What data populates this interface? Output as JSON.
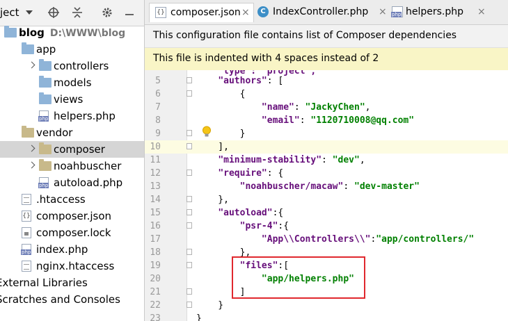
{
  "project_panel": {
    "title": "ject",
    "tree": [
      {
        "label": "blog",
        "hint": "D:\\WWW\\blog",
        "kind": "folder",
        "indent": 0,
        "arrow": "none",
        "bold": true
      },
      {
        "label": "app",
        "kind": "folder",
        "indent": 1,
        "arrow": "none"
      },
      {
        "label": "controllers",
        "kind": "folder",
        "indent": 2,
        "arrow": "closed"
      },
      {
        "label": "models",
        "kind": "folder",
        "indent": 2,
        "arrow": "none"
      },
      {
        "label": "views",
        "kind": "folder",
        "indent": 2,
        "arrow": "none"
      },
      {
        "label": "helpers.php",
        "kind": "php",
        "indent": 2,
        "arrow": "none"
      },
      {
        "label": "vendor",
        "kind": "folder-excluded",
        "indent": 1,
        "arrow": "none"
      },
      {
        "label": "composer",
        "kind": "folder-excluded",
        "indent": 2,
        "arrow": "closed",
        "selected": true
      },
      {
        "label": "noahbuscher",
        "kind": "folder-excluded",
        "indent": 2,
        "arrow": "closed"
      },
      {
        "label": "autoload.php",
        "kind": "php",
        "indent": 2,
        "arrow": "none"
      },
      {
        "label": ".htaccess",
        "kind": "text",
        "indent": 1,
        "arrow": "none"
      },
      {
        "label": "composer.json",
        "kind": "json",
        "indent": 1,
        "arrow": "none"
      },
      {
        "label": "composer.lock",
        "kind": "lock",
        "indent": 1,
        "arrow": "none"
      },
      {
        "label": "index.php",
        "kind": "php",
        "indent": 1,
        "arrow": "none"
      },
      {
        "label": "nginx.htaccess",
        "kind": "text",
        "indent": 1,
        "arrow": "none"
      },
      {
        "label": "External Libraries",
        "kind": "lib",
        "indent": 0,
        "arrow": "none"
      },
      {
        "label": "Scratches and Consoles",
        "kind": "scratch",
        "indent": 0,
        "arrow": "none"
      }
    ]
  },
  "tabs": [
    {
      "label": "composer.json",
      "icon": "json-file-icon",
      "active": true
    },
    {
      "label": "IndexController.php",
      "icon": "php-class-icon",
      "active": false
    },
    {
      "label": "helpers.php",
      "icon": "php-file-icon",
      "active": false
    }
  ],
  "notices": {
    "info": "This configuration file contains list of Composer dependencies",
    "warning": "This file is indented with 4 spaces instead of 2"
  },
  "editor": {
    "first_partial_line": [
      {
        "t": "    \"type\": \"project\",",
        "c": "p"
      }
    ],
    "lines": [
      {
        "n": "5",
        "segs": [
          {
            "t": "    "
          },
          {
            "t": "\"authors\"",
            "c": "k"
          },
          {
            "t": ": ["
          }
        ]
      },
      {
        "n": "6",
        "segs": [
          {
            "t": "        {"
          }
        ]
      },
      {
        "n": "7",
        "segs": [
          {
            "t": "            "
          },
          {
            "t": "\"name\"",
            "c": "k"
          },
          {
            "t": ": "
          },
          {
            "t": "\"JackyChen\"",
            "c": "s"
          },
          {
            "t": ","
          }
        ]
      },
      {
        "n": "8",
        "segs": [
          {
            "t": "            "
          },
          {
            "t": "\"email\"",
            "c": "k"
          },
          {
            "t": ": "
          },
          {
            "t": "\"1120710008@qq.com\"",
            "c": "s"
          }
        ]
      },
      {
        "n": "9",
        "segs": [
          {
            "t": "        }"
          }
        ]
      },
      {
        "n": "10",
        "segs": [
          {
            "t": "    ],"
          }
        ],
        "current": true
      },
      {
        "n": "11",
        "segs": [
          {
            "t": "    "
          },
          {
            "t": "\"minimum-stability\"",
            "c": "k"
          },
          {
            "t": ": "
          },
          {
            "t": "\"dev\"",
            "c": "s"
          },
          {
            "t": ","
          }
        ]
      },
      {
        "n": "12",
        "segs": [
          {
            "t": "    "
          },
          {
            "t": "\"require\"",
            "c": "k"
          },
          {
            "t": ": {"
          }
        ]
      },
      {
        "n": "13",
        "segs": [
          {
            "t": "        "
          },
          {
            "t": "\"noahbuscher/macaw\"",
            "c": "k"
          },
          {
            "t": ": "
          },
          {
            "t": "\"dev-master\"",
            "c": "s"
          }
        ]
      },
      {
        "n": "14",
        "segs": [
          {
            "t": "    },"
          }
        ]
      },
      {
        "n": "15",
        "segs": [
          {
            "t": "    "
          },
          {
            "t": "\"autoload\"",
            "c": "k"
          },
          {
            "t": ":{"
          }
        ]
      },
      {
        "n": "16",
        "segs": [
          {
            "t": "        "
          },
          {
            "t": "\"psr-4\"",
            "c": "k"
          },
          {
            "t": ":{"
          }
        ]
      },
      {
        "n": "17",
        "segs": [
          {
            "t": "            "
          },
          {
            "t": "\"App\\\\Controllers\\\\\"",
            "c": "k"
          },
          {
            "t": ":"
          },
          {
            "t": "\"app/controllers/\"",
            "c": "s"
          }
        ]
      },
      {
        "n": "18",
        "segs": [
          {
            "t": "        },"
          }
        ]
      },
      {
        "n": "19",
        "segs": [
          {
            "t": "        "
          },
          {
            "t": "\"files\"",
            "c": "k"
          },
          {
            "t": ":["
          }
        ]
      },
      {
        "n": "20",
        "segs": [
          {
            "t": "            "
          },
          {
            "t": "\"app/helpers.php\"",
            "c": "s"
          }
        ]
      },
      {
        "n": "21",
        "segs": [
          {
            "t": "        ]"
          }
        ]
      },
      {
        "n": "22",
        "segs": [
          {
            "t": "    }"
          }
        ]
      },
      {
        "n": "23",
        "segs": [
          {
            "t": "}"
          }
        ]
      }
    ]
  }
}
